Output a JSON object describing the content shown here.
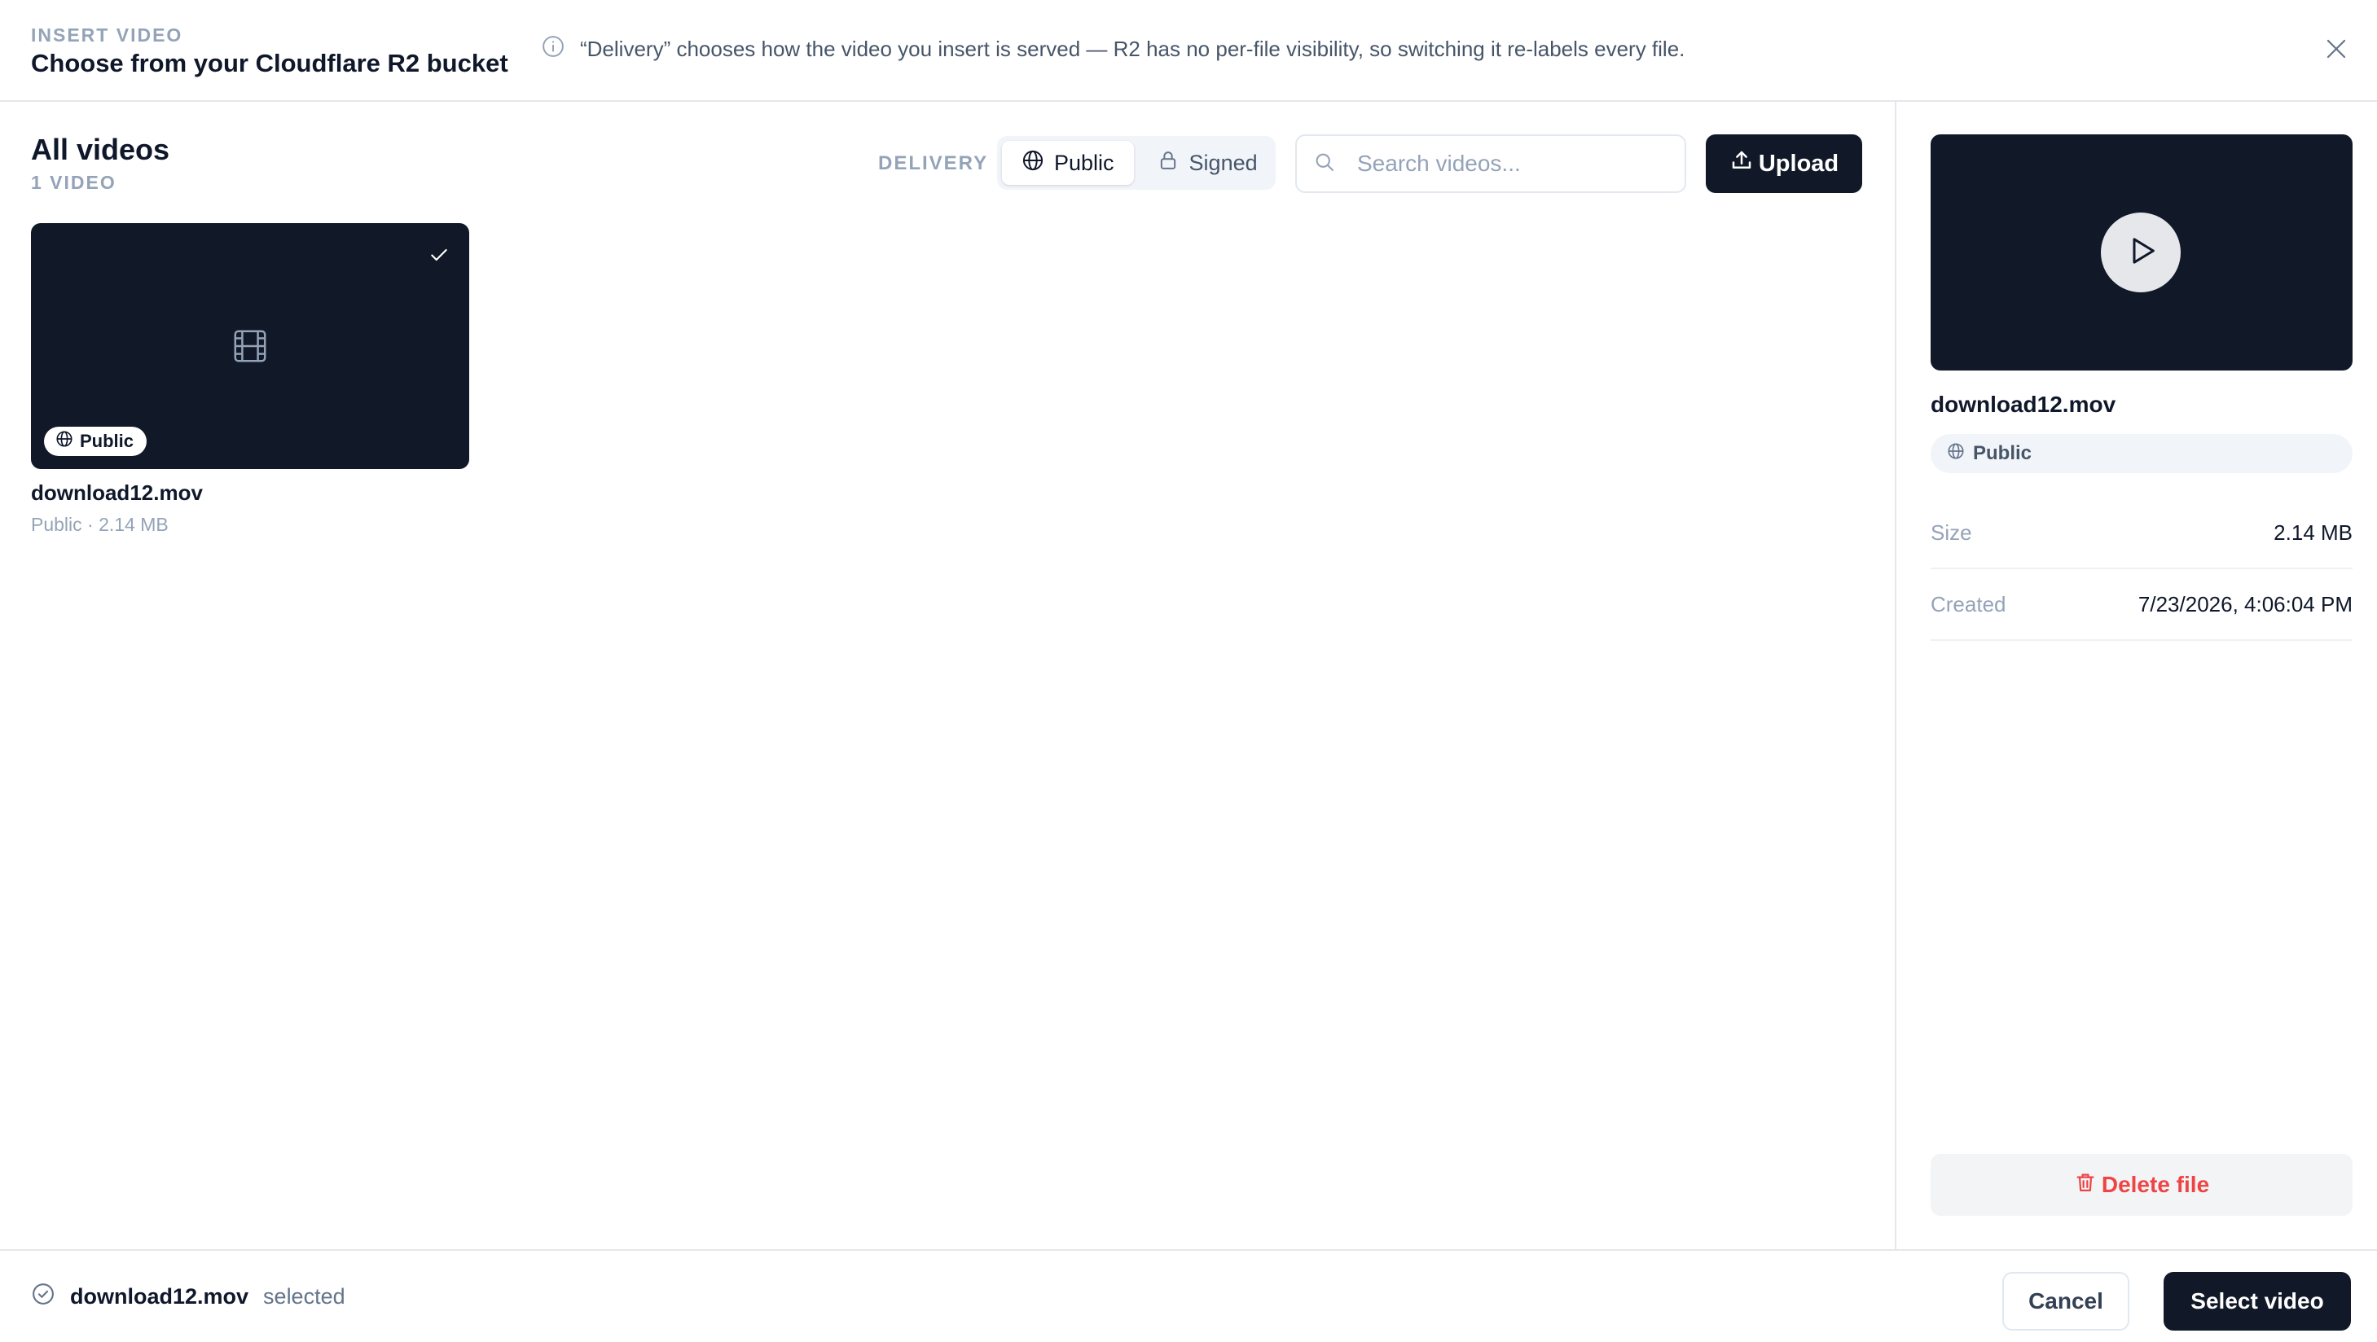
{
  "header": {
    "eyebrow": "INSERT VIDEO",
    "title": "Choose from your Cloudflare R2 bucket",
    "notice": "“Delivery” chooses how the video you insert is served — R2 has no per-file visibility, so switching it re-labels every file.",
    "close_icon": "close-icon",
    "info_icon": "info-icon"
  },
  "library": {
    "title": "All videos",
    "count": "1 VIDEO",
    "delivery_label": "DELIVERY",
    "delivery_options": [
      {
        "label": "Public",
        "icon": "globe-icon",
        "active": true
      },
      {
        "label": "Signed",
        "icon": "lock-icon",
        "active": false
      }
    ],
    "search": {
      "placeholder": "Search videos...",
      "value": ""
    },
    "upload_label": "Upload",
    "videos": [
      {
        "name": "download12.mov",
        "badge": "Public",
        "meta": "Public · 2.14 MB",
        "selected": true
      }
    ]
  },
  "details": {
    "name": "download12.mov",
    "visibility": "Public",
    "rows": [
      {
        "key": "Size",
        "value": "2.14 MB"
      },
      {
        "key": "Created",
        "value": "7/23/2026, 4:06:04 PM"
      }
    ],
    "delete_label": "Delete file"
  },
  "footer": {
    "selected_name": "download12.mov",
    "selected_suffix": "selected",
    "cancel_label": "Cancel",
    "confirm_label": "Select video"
  },
  "colors": {
    "primary": "#111827",
    "danger": "#ef4444",
    "muted": "#94a3b8",
    "border": "#e5e7eb"
  }
}
